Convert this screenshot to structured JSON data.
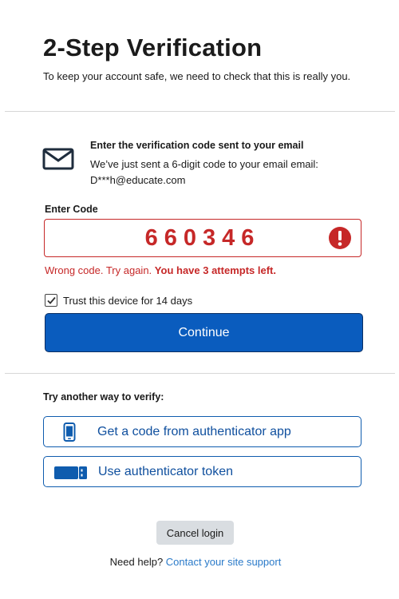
{
  "header": {
    "title": "2-Step Verification",
    "subtitle": "To keep your account safe, we need to check that this is really you."
  },
  "verification": {
    "heading": "Enter the verification code sent to your email",
    "message_line1": "We’ve just sent a 6-digit code to your email email:",
    "message_line2": "D***h@educate.com",
    "icon": "envelope-icon"
  },
  "code_field": {
    "label": "Enter Code",
    "value": "660346",
    "error_icon": "error-exclamation-icon",
    "error_text": "Wrong code. Try again.",
    "error_attempts": "You have 3 attempts left."
  },
  "trust": {
    "label": "Trust this device for 14 days",
    "checked": true
  },
  "continue_label": "Continue",
  "alternatives": {
    "heading": "Try another way to verify:",
    "options": [
      {
        "label": "Get a code from authenticator app",
        "icon": "mobile-phone-icon"
      },
      {
        "label": "Use authenticator token",
        "icon": "usb-token-icon"
      }
    ]
  },
  "cancel_label": "Cancel login",
  "help": {
    "text": "Need help?",
    "link": "Contact your site support"
  },
  "colors": {
    "primary": "#0a5cbe",
    "error": "#c62828",
    "link": "#2a7ac9"
  }
}
